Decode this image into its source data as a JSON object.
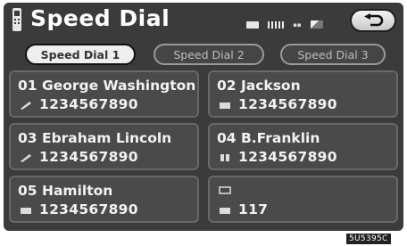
{
  "header": {
    "title": "Speed Dial"
  },
  "tabs": [
    {
      "label": "Speed Dial 1",
      "active": true
    },
    {
      "label": "Speed Dial 2",
      "active": false
    },
    {
      "label": "Speed Dial 3",
      "active": false
    }
  ],
  "entries": [
    {
      "number": "01",
      "name": "George Washington",
      "phone": "1234567890",
      "icon": "pen-icon"
    },
    {
      "number": "02",
      "name": "Jackson",
      "phone": "1234567890",
      "icon": "home-icon"
    },
    {
      "number": "03",
      "name": "Ebraham Lincoln",
      "phone": "1234567890",
      "icon": "pen-icon"
    },
    {
      "number": "04",
      "name": "B.Franklin",
      "phone": "1234567890",
      "icon": "mobile-icon"
    },
    {
      "number": "05",
      "name": "Hamilton",
      "phone": "1234567890",
      "icon": "home-icon"
    },
    {
      "number": "",
      "name": "",
      "phone": "117",
      "icon": "home-icon"
    }
  ],
  "image_code": "5U5395C",
  "colors": {
    "screen_bg": "#3b3b3b",
    "entry_bg": "#4a4a4a",
    "text": "#f2f2f2"
  }
}
